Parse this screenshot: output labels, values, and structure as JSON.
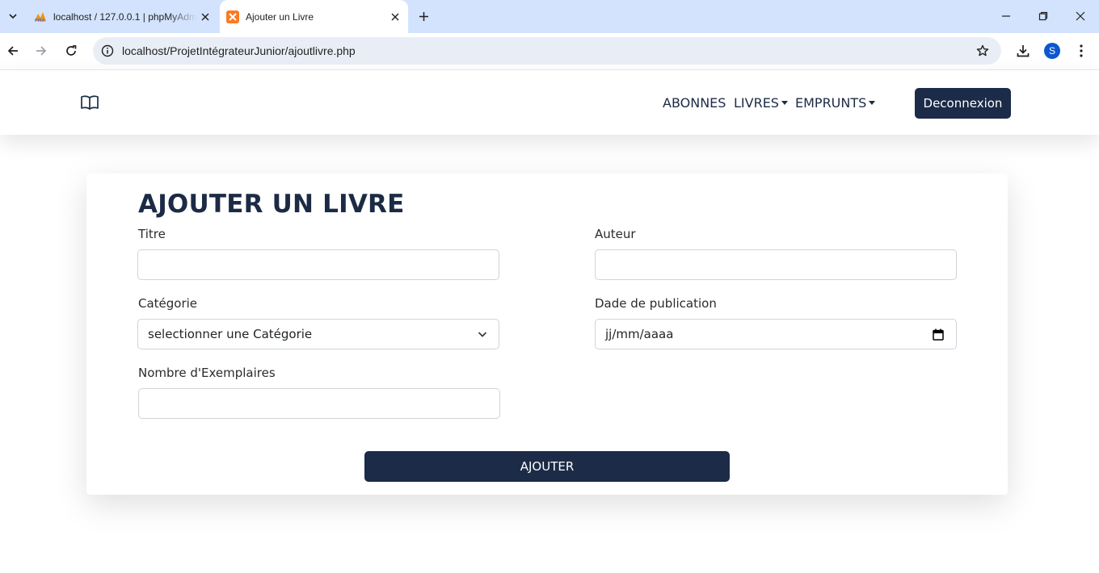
{
  "browser": {
    "tabs": [
      {
        "title": "localhost / 127.0.0.1 | phpMyAdmin",
        "icon": "phpmyadmin-icon",
        "active": false
      },
      {
        "title": "Ajouter un Livre",
        "icon": "xampp-icon",
        "active": true
      }
    ],
    "url": "localhost/ProjetIntégrateurJunior/ajoutlivre.php",
    "profile_initial": "S"
  },
  "navbar": {
    "brand_icon": "book-icon",
    "links": [
      {
        "label": "ABONNES",
        "dropdown": false
      },
      {
        "label": "LIVRES",
        "dropdown": true
      },
      {
        "label": "EMPRUNTS",
        "dropdown": true
      }
    ],
    "logout_label": "Deconnexion"
  },
  "form": {
    "title": "AJOUTER UN LIVRE",
    "titre_label": "Titre",
    "titre_value": "",
    "auteur_label": "Auteur",
    "auteur_value": "",
    "categorie_label": "Catégorie",
    "categorie_selected": "selectionner une Catégorie",
    "date_label": "Dade de publication",
    "date_placeholder": "jj/mm/aaaa",
    "exemplaires_label": "Nombre d'Exemplaires",
    "exemplaires_value": "",
    "submit_label": "AJOUTER"
  },
  "colors": {
    "primary": "#1c2b47",
    "tabstrip": "#d3e3fd",
    "omnibox": "#e9eef6"
  }
}
